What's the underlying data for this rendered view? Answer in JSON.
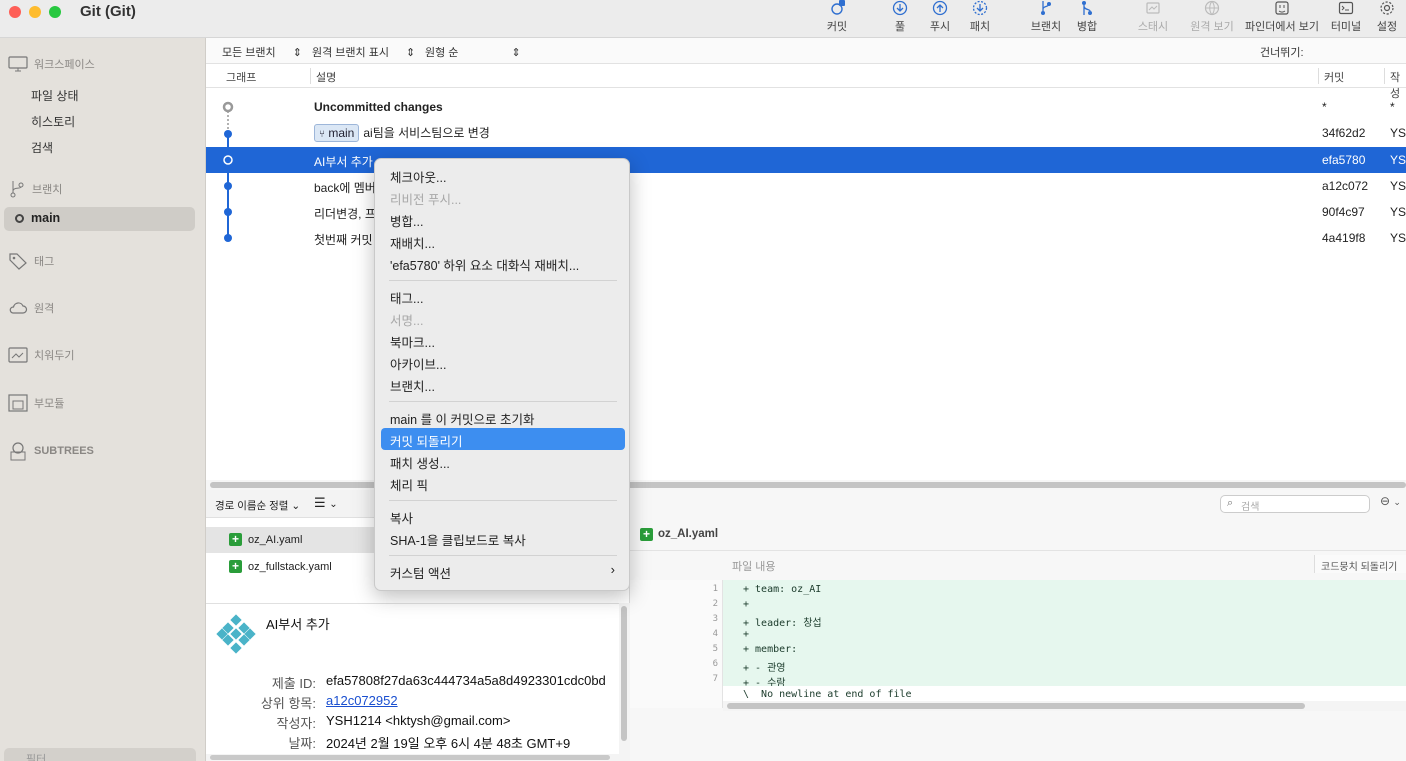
{
  "window": {
    "title": "Git (Git)"
  },
  "toolbar": [
    {
      "label": "커밋",
      "icon": "commit-icon",
      "enabled": true
    },
    {
      "label": "풀",
      "icon": "pull-icon",
      "enabled": true
    },
    {
      "label": "푸시",
      "icon": "push-icon",
      "enabled": true
    },
    {
      "label": "패치",
      "icon": "fetch-icon",
      "enabled": true
    },
    {
      "label": "브랜치",
      "icon": "branch-icon",
      "enabled": true
    },
    {
      "label": "병합",
      "icon": "merge-icon",
      "enabled": true
    },
    {
      "label": "스태시",
      "icon": "stash-icon",
      "enabled": false
    },
    {
      "label": "원격 보기",
      "icon": "globe-icon",
      "enabled": false
    },
    {
      "label": "파인더에서 보기",
      "icon": "finder-icon",
      "enabled": true
    },
    {
      "label": "터미널",
      "icon": "terminal-icon",
      "enabled": true
    },
    {
      "label": "설정",
      "icon": "gear-icon",
      "enabled": true
    }
  ],
  "sidebar": {
    "workspace": "워크스페이스",
    "workspace_items": [
      "파일 상태",
      "히스토리",
      "검색"
    ],
    "branches": "브랜치",
    "current_branch": "main",
    "tags": "태그",
    "remotes": "원격",
    "stashes": "치워두기",
    "submodules": "부모듈",
    "subtrees": "SUBTREES",
    "filter_placeholder": "필터"
  },
  "filters": {
    "branches": "모든 브랜치",
    "remote": "원격 브랜치 표시",
    "order": "원형 순",
    "jump": "건너뛰기:"
  },
  "columns": {
    "graph": "그래프",
    "description": "설명",
    "commit": "커밋",
    "author": "작성"
  },
  "commits": [
    {
      "desc": "Uncommitted changes",
      "hash": "*",
      "author": "*",
      "bold": true
    },
    {
      "branch": "main",
      "desc": "ai팀을 서비스팀으로 변경",
      "hash": "34f62d2",
      "author": "YS"
    },
    {
      "desc": "AI부서 추가",
      "hash": "efa5780",
      "author": "YS",
      "selected": true
    },
    {
      "desc": "back에 멤버",
      "hash": "a12c072",
      "author": "YS"
    },
    {
      "desc": "리더변경, 프",
      "hash": "90f4c97",
      "author": "YS"
    },
    {
      "desc": "첫번째 커밋",
      "hash": "4a419f8",
      "author": "YS"
    }
  ],
  "context_menu": [
    {
      "label": "체크아웃...",
      "enabled": true
    },
    {
      "label": "리비전 푸시...",
      "enabled": false
    },
    {
      "label": "병합...",
      "enabled": true
    },
    {
      "label": "재배치...",
      "enabled": true
    },
    {
      "label": "'efa5780' 하위 요소 대화식 재배치...",
      "enabled": true
    },
    {
      "label": "태그...",
      "enabled": true
    },
    {
      "label": "서명...",
      "enabled": false
    },
    {
      "label": "북마크...",
      "enabled": true
    },
    {
      "label": "아카이브...",
      "enabled": true
    },
    {
      "label": "브랜치...",
      "enabled": true
    },
    {
      "label": "main 를 이 커밋으로 초기화",
      "enabled": true
    },
    {
      "label": "커밋 되돌리기",
      "enabled": true,
      "highlighted": true
    },
    {
      "label": "패치 생성...",
      "enabled": true
    },
    {
      "label": "체리 픽",
      "enabled": true
    },
    {
      "label": "복사",
      "enabled": true
    },
    {
      "label": "SHA-1을 클립보드로 복사",
      "enabled": true
    },
    {
      "label": "커스텀 액션",
      "enabled": true,
      "submenu": true
    }
  ],
  "files_panel": {
    "sort": "경로 이름순 정렬",
    "files": [
      "oz_AI.yaml",
      "oz_fullstack.yaml"
    ]
  },
  "commit_info": {
    "title": "AI부서 추가",
    "labels": {
      "sha": "제출 ID:",
      "parent": "상위 항목:",
      "author": "작성자:",
      "date": "날짜:"
    },
    "sha": "efa57808f27da63c444734a5a8d4923301cdc0bd",
    "parent": "a12c072952",
    "author": "YSH1214 <hktysh@gmail.com>",
    "date": "2024년 2월 19일 오후 6시 4분 48초 GMT+9"
  },
  "diff": {
    "search_placeholder": "검색",
    "file": "oz_AI.yaml",
    "header": "파일 내용",
    "revert_hunk": "코드뭉치 되돌리기",
    "lines": [
      "+ team: oz_AI",
      "+",
      "+ leader: 창섭",
      "+",
      "+ member:",
      "+ - 관영",
      "+ - 수람"
    ],
    "no_newline": "\\  No newline at end of file"
  }
}
